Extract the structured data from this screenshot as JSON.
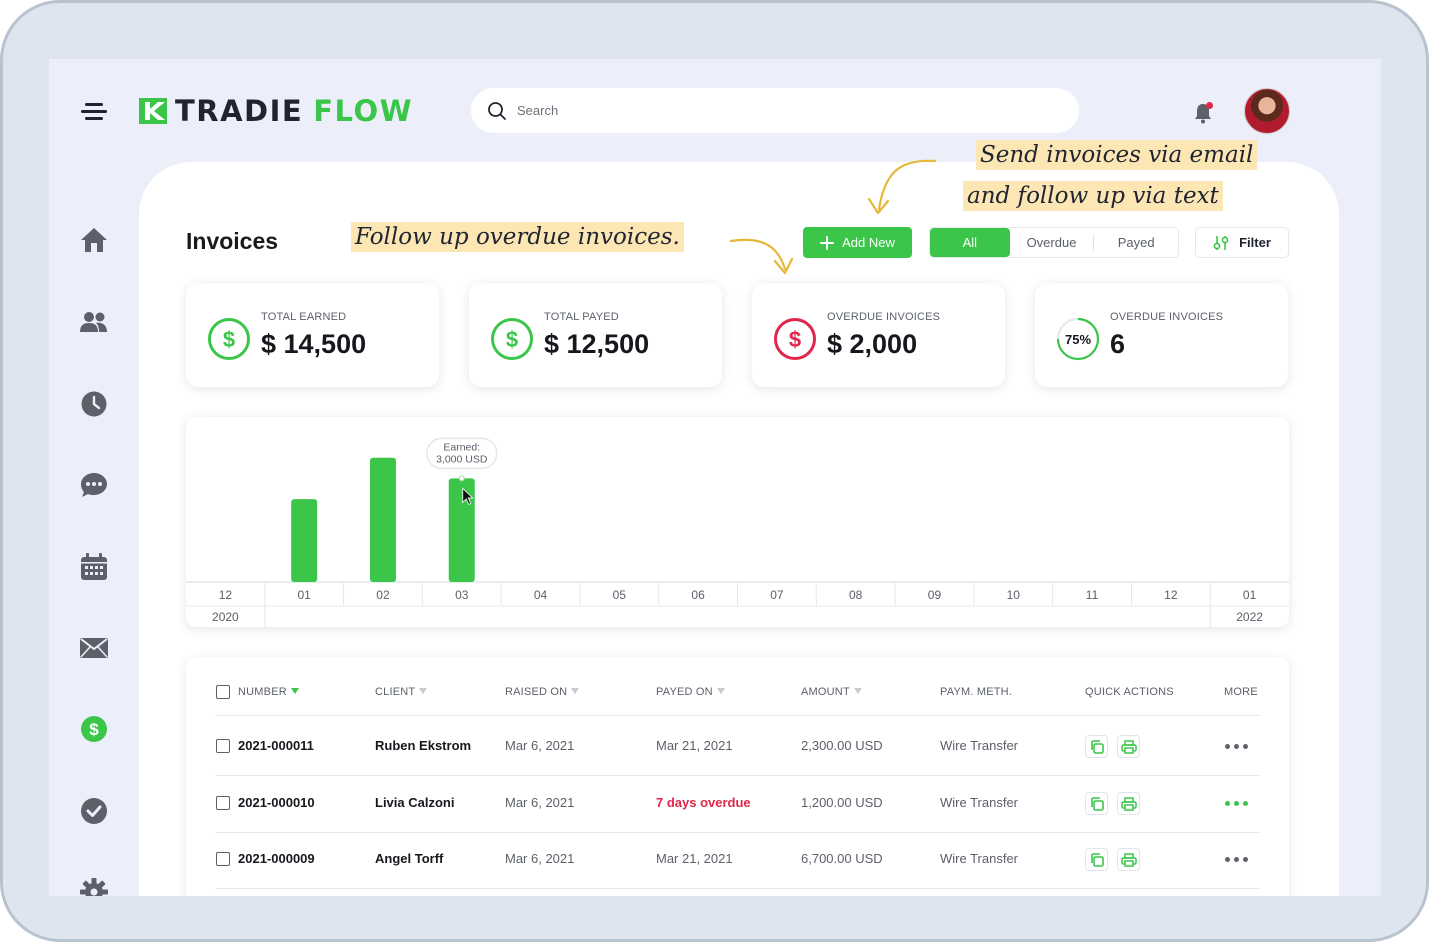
{
  "app": {
    "logo_part1": "TRADIE",
    "logo_part2": "FLOW"
  },
  "search": {
    "placeholder": "Search"
  },
  "colors": {
    "accent": "#3bc64a",
    "danger": "#e0264a",
    "note_highlight": "#fbe6b4"
  },
  "sidebar": {
    "items": [
      {
        "icon": "home-icon"
      },
      {
        "icon": "users-icon"
      },
      {
        "icon": "clock-icon"
      },
      {
        "icon": "chat-icon"
      },
      {
        "icon": "calendar-icon"
      },
      {
        "icon": "mail-icon"
      },
      {
        "icon": "dollar-icon",
        "active": true
      },
      {
        "icon": "check-icon"
      },
      {
        "icon": "gear-icon"
      }
    ]
  },
  "page": {
    "title": "Invoices"
  },
  "annotations": {
    "overdue_note": "Follow up overdue invoices.",
    "send_note_line1": "Send invoices via email",
    "send_note_line2": "and follow up via text"
  },
  "toolbar": {
    "add_new": "Add New",
    "filters": [
      "All",
      "Overdue",
      "Payed"
    ],
    "active_filter": "All",
    "filter_label": "Filter"
  },
  "stats": [
    {
      "label": "TOTAL EARNED",
      "value": "$ 14,500",
      "icon": "dollar-circle-icon",
      "color": "#3bc64a"
    },
    {
      "label": "TOTAL PAYED",
      "value": "$ 12,500",
      "icon": "dollar-circle-icon",
      "color": "#3bc64a"
    },
    {
      "label": "OVERDUE INVOICES",
      "value": "$ 2,000",
      "icon": "dollar-circle-icon",
      "color": "#e0264a"
    },
    {
      "label": "OVERDUE INVOICES",
      "value": "6",
      "progress_label": "75%",
      "progress": 0.75
    }
  ],
  "chart_data": {
    "type": "bar",
    "categories": [
      "12",
      "01",
      "02",
      "03",
      "04",
      "05",
      "06",
      "07",
      "08",
      "09",
      "10",
      "11",
      "12",
      "01"
    ],
    "year_labels": [
      {
        "label": "2020",
        "category_index": 0
      },
      {
        "label": "2022",
        "category_index": 13
      }
    ],
    "values": [
      0,
      2000,
      3000,
      2500,
      0,
      0,
      0,
      0,
      0,
      0,
      0,
      0,
      0,
      0
    ],
    "ylim": [
      0,
      3500
    ],
    "tooltip": {
      "line1": "Earned:",
      "line2": "3,000 USD",
      "category_index": 3
    }
  },
  "table": {
    "headers": [
      {
        "label": "NUMBER",
        "sort": "active"
      },
      {
        "label": "CLIENT",
        "sort": "inactive"
      },
      {
        "label": "RAISED ON",
        "sort": "inactive"
      },
      {
        "label": "PAYED ON",
        "sort": "inactive"
      },
      {
        "label": "AMOUNT",
        "sort": "inactive"
      },
      {
        "label": "PAYM. METH.",
        "sort": "none"
      },
      {
        "label": "QUICK ACTIONS",
        "sort": "none"
      },
      {
        "label": "MORE",
        "sort": "none"
      }
    ],
    "rows": [
      {
        "number": "2021-000011",
        "client": "Ruben Ekstrom",
        "raised": "Mar 6, 2021",
        "payed": "Mar 21, 2021",
        "amount": "2,300.00 USD",
        "method": "Wire Transfer",
        "overdue": false
      },
      {
        "number": "2021-000010",
        "client": "Livia Calzoni",
        "raised": "Mar 6, 2021",
        "payed": "7 days overdue",
        "amount": "1,200.00 USD",
        "method": "Wire Transfer",
        "overdue": true
      },
      {
        "number": "2021-000009",
        "client": "Angel Torff",
        "raised": "Mar 6, 2021",
        "payed": "Mar 21, 2021",
        "amount": "6,700.00 USD",
        "method": "Wire Transfer",
        "overdue": false
      }
    ]
  }
}
